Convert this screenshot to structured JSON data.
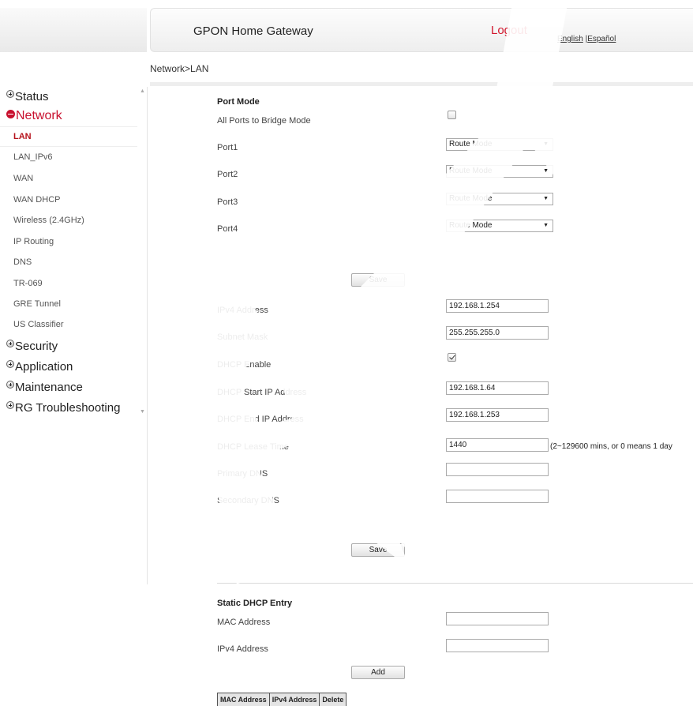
{
  "header": {
    "app_title": "GPON Home Gateway",
    "logout": "Logout",
    "lang_english": "English",
    "lang_separator": " |",
    "lang_espanol": "Español"
  },
  "breadcrumb": "Network>LAN",
  "sidebar": {
    "groups": [
      {
        "label": "Status",
        "expanded": false
      },
      {
        "label": "Network",
        "expanded": true
      },
      {
        "label": "Security",
        "expanded": false
      },
      {
        "label": "Application",
        "expanded": false
      },
      {
        "label": "Maintenance",
        "expanded": false
      },
      {
        "label": "RG Troubleshooting",
        "expanded": false
      }
    ],
    "network_items": [
      "LAN",
      "LAN_IPv6",
      "WAN",
      "WAN DHCP",
      "Wireless (2.4GHz)",
      "IP Routing",
      "DNS",
      "TR-069",
      "GRE Tunnel",
      "US Classifier"
    ],
    "active_item": "LAN"
  },
  "port_mode": {
    "heading": "Port Mode",
    "bridge_label": "All Ports to Bridge Mode",
    "bridge_checked": false,
    "ports": [
      {
        "label": "Port1",
        "value": "Route Mode"
      },
      {
        "label": "Port2",
        "value": "Route Mode"
      },
      {
        "label": "Port3",
        "value": "Route Mode"
      },
      {
        "label": "Port4",
        "value": "Route Mode"
      }
    ],
    "save_label": "Save"
  },
  "lan": {
    "ipv4_label": "IPv4 Address",
    "ipv4_value": "192.168.1.254",
    "subnet_label": "Subnet Mask",
    "subnet_value": "255.255.255.0",
    "dhcp_enable_label": "DHCP Enable",
    "dhcp_enable_checked": true,
    "dhcp_start_label": "DHCP Start IP Address",
    "dhcp_start_value": "192.168.1.64",
    "dhcp_end_label": "DHCP End IP Address",
    "dhcp_end_value": "192.168.1.253",
    "lease_label": "DHCP Lease Time",
    "lease_value": "1440",
    "lease_hint": "(2~129600 mins, or 0 means 1 day",
    "primary_dns_label": "Primary DNS",
    "primary_dns_value": "",
    "secondary_dns_label": "Secondary DNS",
    "secondary_dns_value": "",
    "save_label": "Save"
  },
  "static_dhcp": {
    "heading": "Static DHCP Entry",
    "mac_label": "MAC Address",
    "mac_value": "",
    "ipv4_label": "IPv4 Address",
    "ipv4_value": "",
    "add_label": "Add",
    "table_headers": [
      "MAC Address",
      "IPv4 Address",
      "Delete"
    ]
  },
  "watermark": "DRAFT",
  "colors": {
    "accent": "#c8102e",
    "watermark": "#ffffff"
  }
}
